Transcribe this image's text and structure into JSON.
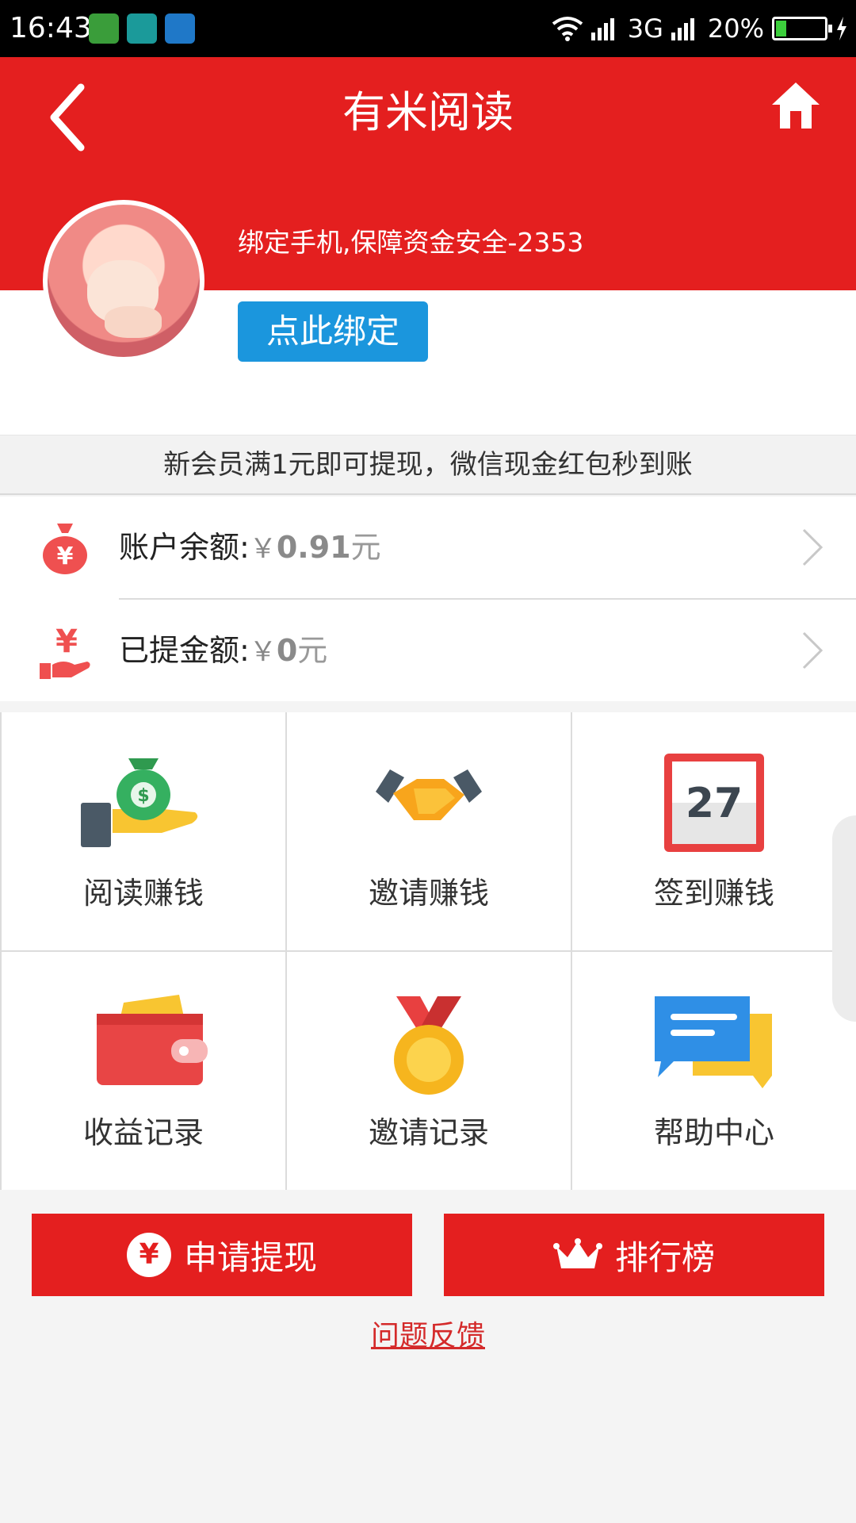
{
  "status_bar": {
    "time": "16:43",
    "network": "3G",
    "battery": "20%",
    "battery_level": 0.2
  },
  "header": {
    "title": "有米阅读",
    "back_icon": "back-chevron-icon",
    "home_icon": "home-icon"
  },
  "profile": {
    "bind_tip": "绑定手机,保障资金安全-2353",
    "bind_button": "点此绑定"
  },
  "notice": "新会员满1元即可提现，微信现金红包秒到账",
  "account": {
    "balance_label": "账户余额:",
    "balance_currency": "￥",
    "balance_amount": "0.91",
    "balance_unit": "元",
    "withdrawn_label": "已提金额:",
    "withdrawn_currency": "￥",
    "withdrawn_amount": "0",
    "withdrawn_unit": "元"
  },
  "grid": {
    "items": [
      {
        "label": "阅读赚钱",
        "icon": "money-bag-hand-icon"
      },
      {
        "label": "邀请赚钱",
        "icon": "handshake-icon"
      },
      {
        "label": "签到赚钱",
        "icon": "calendar-icon",
        "calendar_day": "27"
      },
      {
        "label": "收益记录",
        "icon": "wallet-icon"
      },
      {
        "label": "邀请记录",
        "icon": "medal-icon"
      },
      {
        "label": "帮助中心",
        "icon": "chat-bubbles-icon"
      }
    ]
  },
  "actions": {
    "withdraw": "申请提现",
    "withdraw_badge": "¥",
    "ranking": "排行榜",
    "feedback": "问题反馈"
  },
  "colors": {
    "brand_red": "#e41f1f",
    "bind_blue": "#1b96dd"
  }
}
